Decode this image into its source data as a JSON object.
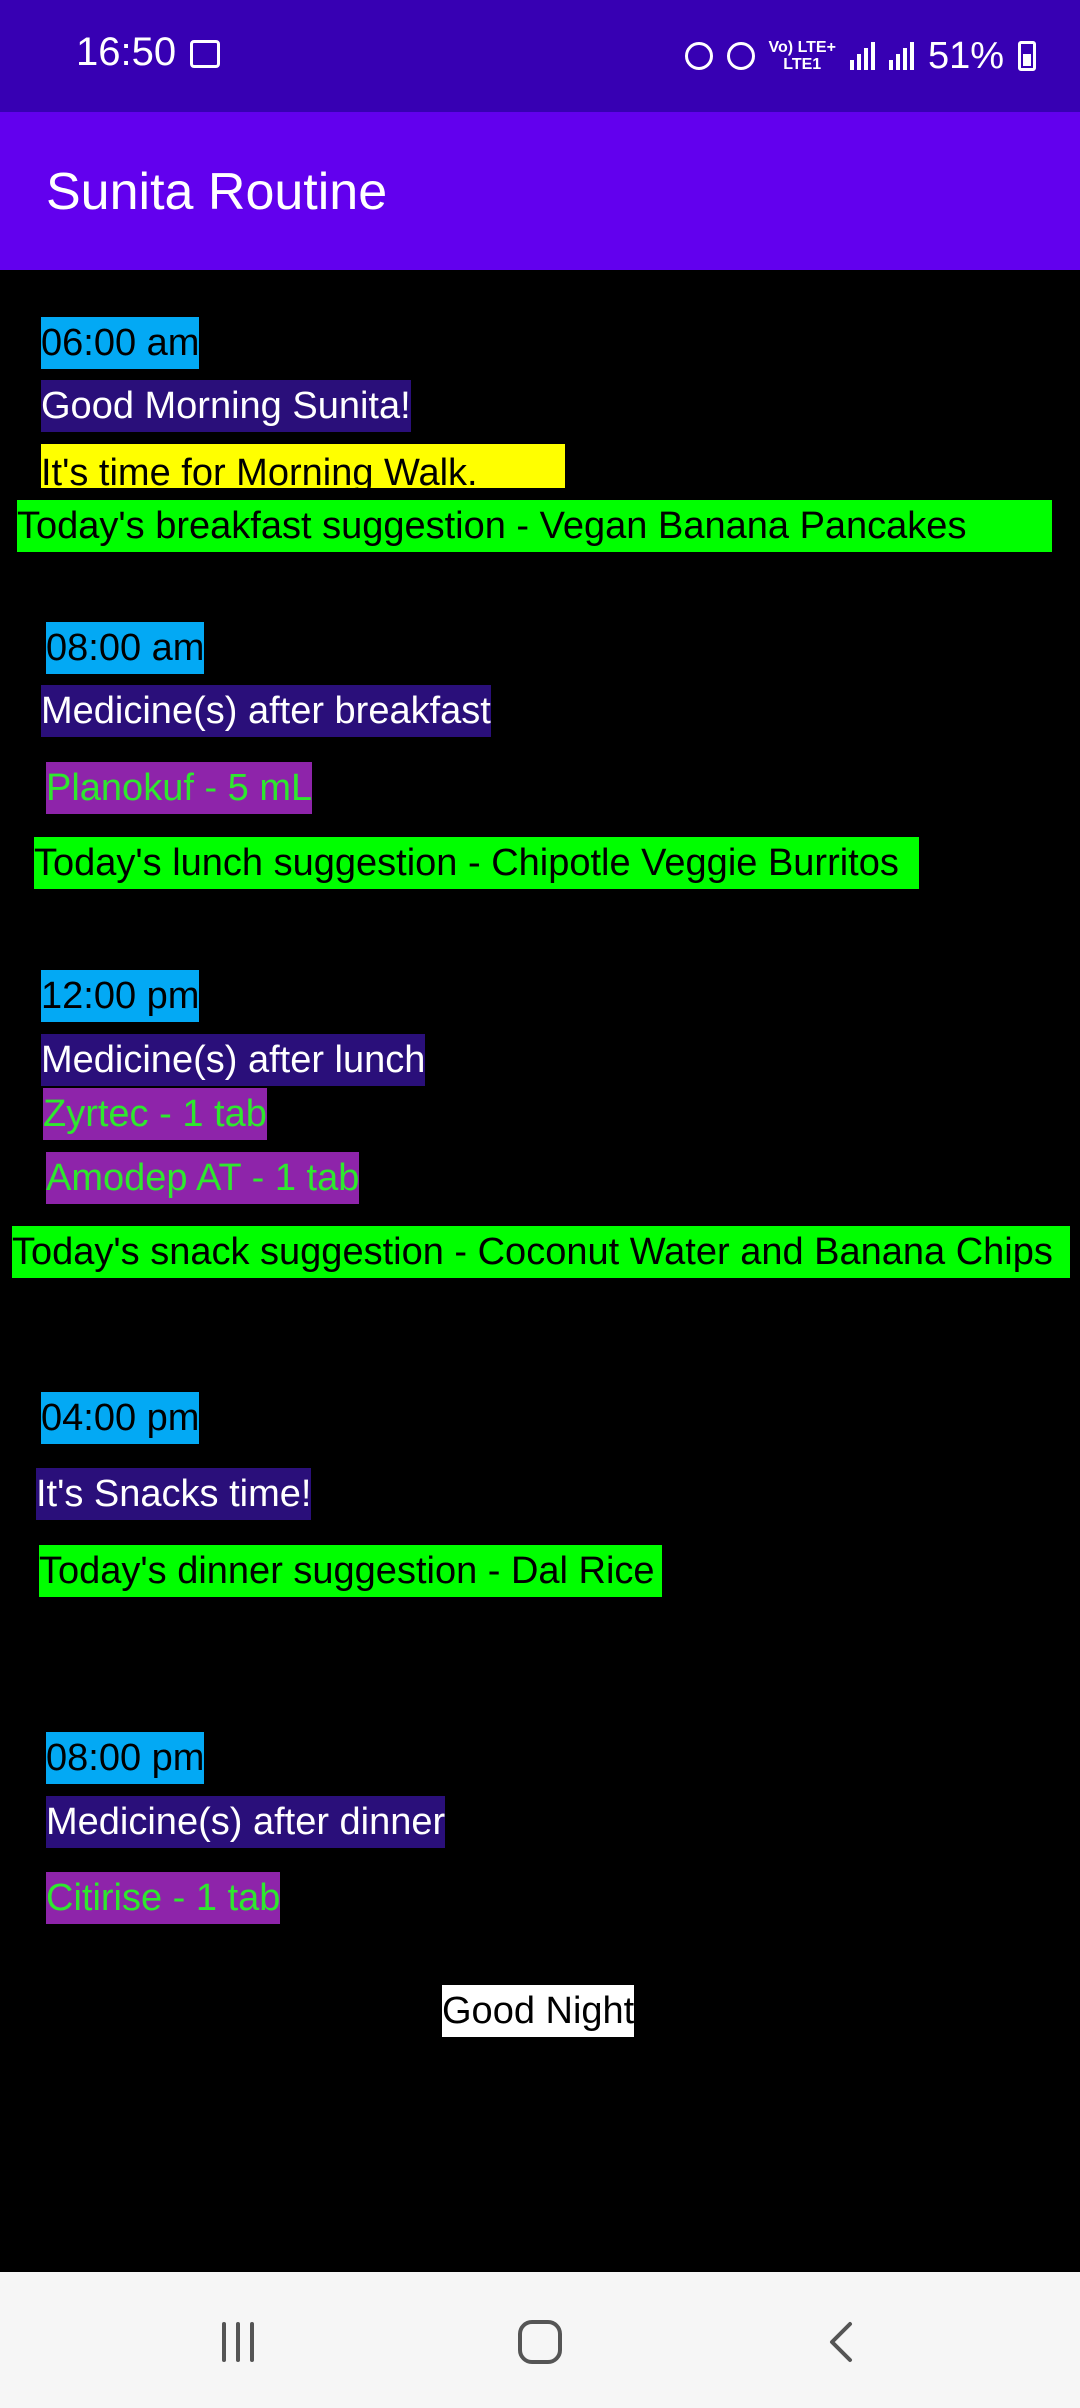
{
  "status_bar": {
    "time": "16:50",
    "network": "Vo) LTE+\nLTE1",
    "battery": "51%"
  },
  "app_bar": {
    "title": "Sunita Routine"
  },
  "schedule": {
    "morning": {
      "time": "06:00 am",
      "greeting": "Good Morning Sunita!",
      "activity": "It's time for Morning Walk.",
      "suggestion": "Today's breakfast suggestion - Vegan Banana Pancakes"
    },
    "breakfast": {
      "time": "08:00 am",
      "heading": "Medicine(s) after breakfast",
      "medicines": [
        "Planokuf - 5 mL"
      ],
      "suggestion": "Today's lunch suggestion - Chipotle Veggie Burritos"
    },
    "lunch": {
      "time": "12:00 pm",
      "heading": "Medicine(s) after lunch",
      "medicines": [
        "Zyrtec - 1 tab",
        "Amodep AT - 1 tab"
      ],
      "suggestion": "Today's snack suggestion - Coconut Water and Banana Chips"
    },
    "snacks": {
      "time": "04:00 pm",
      "heading": "It's Snacks time!",
      "suggestion": "Today's dinner suggestion - Dal Rice"
    },
    "dinner": {
      "time": "08:00 pm",
      "heading": "Medicine(s) after dinner",
      "medicines": [
        "Citirise - 1 tab"
      ]
    },
    "closing": "Good Night"
  },
  "colors": {
    "status_bar": "#3700b3",
    "app_bar": "#6200ee",
    "time_bg": "#03a9f4",
    "heading_bg": "#2a0f7a",
    "activity_bg": "#ffff00",
    "suggestion_bg": "#00ff00",
    "medicine_bg": "#8e24aa",
    "medicine_text": "#2ee82e"
  },
  "nav_bar": {
    "icons": [
      "recents-icon",
      "home-icon",
      "back-icon"
    ]
  }
}
